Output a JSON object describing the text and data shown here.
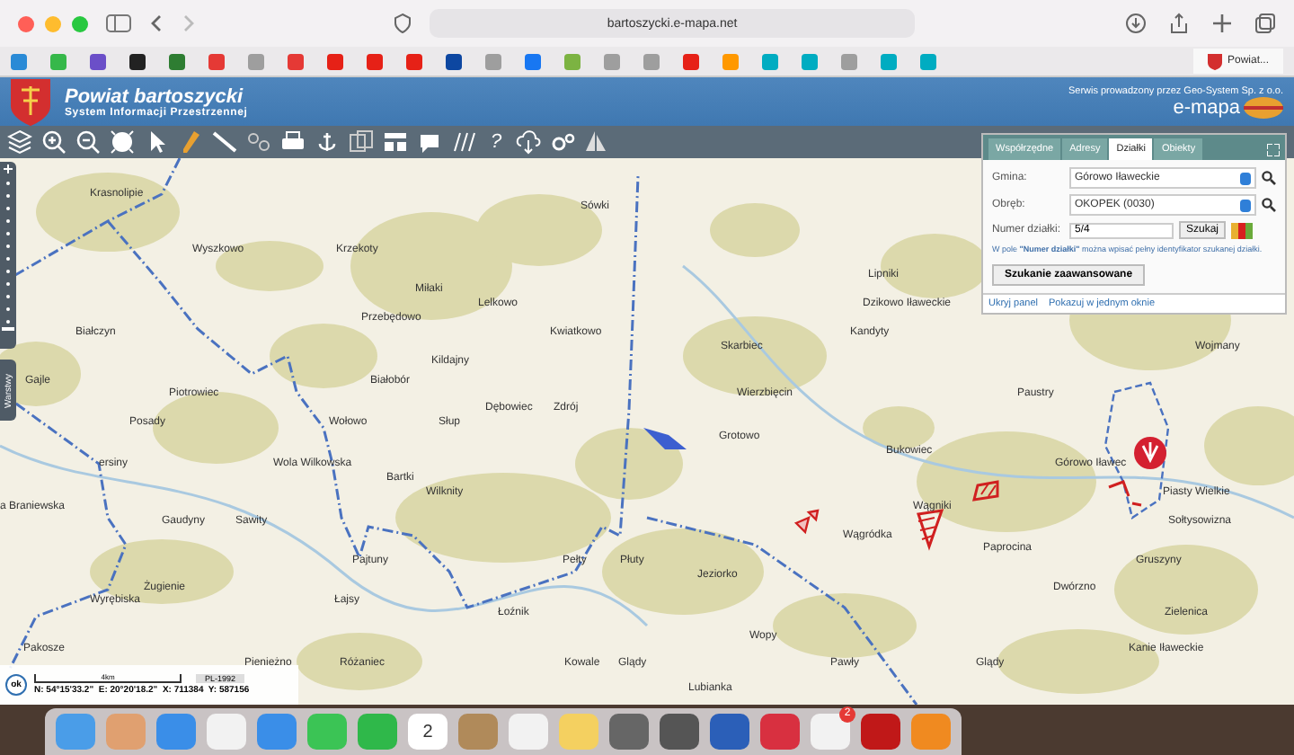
{
  "browser": {
    "address": "bartoszycki.e-mapa.net",
    "bookmarks": [
      {
        "color": "#2a8ad6"
      },
      {
        "color": "#36b84a"
      },
      {
        "color": "#6b4fc8"
      },
      {
        "color": "#222222"
      },
      {
        "color": "#2e7d32"
      },
      {
        "color": "#e53935"
      },
      {
        "color": "#9e9e9e"
      },
      {
        "color": "#e53935"
      },
      {
        "color": "#e62117"
      },
      {
        "color": "#e62117"
      },
      {
        "color": "#e62117"
      },
      {
        "color": "#0d47a1"
      },
      {
        "color": "#9e9e9e"
      },
      {
        "color": "#1877f2"
      },
      {
        "color": "#7cb342"
      },
      {
        "color": "#9e9e9e"
      },
      {
        "color": "#9e9e9e"
      },
      {
        "color": "#e62117"
      },
      {
        "color": "#ff9800"
      },
      {
        "color": "#00acc1"
      },
      {
        "color": "#00acc1"
      },
      {
        "color": "#9e9e9e"
      },
      {
        "color": "#00acc1"
      },
      {
        "color": "#00acc1"
      }
    ],
    "tab_title": "Powiat..."
  },
  "header": {
    "title": "Powiat bartoszycki",
    "subtitle": "System Informacji Przestrzennej",
    "provider": "Serwis prowadzony przez Geo-System Sp. z o.o.",
    "brand": "e-mapa"
  },
  "toolbar": {
    "help": "?"
  },
  "side": {
    "layers_tab": "Warstwy"
  },
  "panel": {
    "tabs": [
      {
        "label": "Współrzędne",
        "selected": false
      },
      {
        "label": "Adresy",
        "selected": false
      },
      {
        "label": "Działki",
        "selected": true
      },
      {
        "label": "Obiekty",
        "selected": false
      }
    ],
    "fields": [
      {
        "label": "Gmina:",
        "value": "Górowo Iławeckie"
      },
      {
        "label": "Obręb:",
        "value": "OKOPEK (0030)"
      }
    ],
    "parcel": {
      "label": "Numer działki:",
      "value": "5/4"
    },
    "search_button": "Szukaj",
    "swatches": [
      {
        "color": "#e8b030"
      },
      {
        "color": "#d82020"
      },
      {
        "color": "#6aaa3a"
      }
    ],
    "hint": "W pole **\"Numer działki\"** można wpisać pełny identyfikator szukanej działki.",
    "advanced_button": "Szukanie zaawansowane",
    "links": [
      "Ukryj panel",
      "Pokazuj w jednym oknie"
    ]
  },
  "map": {
    "zoom": {
      "level": 0.1
    },
    "places": [
      "Krasnolipie",
      "Sówki",
      "Wyszkowo",
      "Krzekoty",
      "Lipniki",
      "Miłaki",
      "Lelkowo",
      "Dzikowo Iławeckie",
      "Przebędowo",
      "Białczyn",
      "Kwiatkowo",
      "Kandyty",
      "Skarbiec",
      "Wojmany",
      "Kildajny",
      "Gajle",
      "Białobór",
      "Piotrowiec",
      "Wierzbięcin",
      "Paustry",
      "Dębowiec",
      "Zdrój",
      "Posady",
      "Wołowo",
      "Słup",
      "Grotowo",
      "Bukowiec",
      "ersiny",
      "Wola Wilkowska",
      "Górowo Iławec",
      "Bartki",
      "Wilknity",
      "Piasty Wielkie",
      "a Braniewska",
      "Wągniki",
      "Gaudyny",
      "Sawity",
      "Sołtysowizna",
      "Wągródka",
      "Paprocina",
      "Pajtuny",
      "Pełty",
      "Płuty",
      "Gruszyny",
      "Jeziorko",
      "Żugienie",
      "Dwórzno",
      "Wyrębiska",
      "Łajsy",
      "Łoźnik",
      "Zielenica",
      "Wopy",
      "Pakosze",
      "Kanie Iławeckie",
      "Pieniężno",
      "Różaniec",
      "Kowale",
      "Glądy",
      "Pawły",
      "Glądy",
      "Lubianka"
    ]
  },
  "status": {
    "ok": "ok",
    "scale": "4km",
    "system": "PL-1992",
    "coords": "N: 54°15'33.2\"  E: 20°20'18.2\"  X: 711384  Y: 587156"
  },
  "dock": {
    "calendar_day": "2",
    "badge": "2"
  }
}
